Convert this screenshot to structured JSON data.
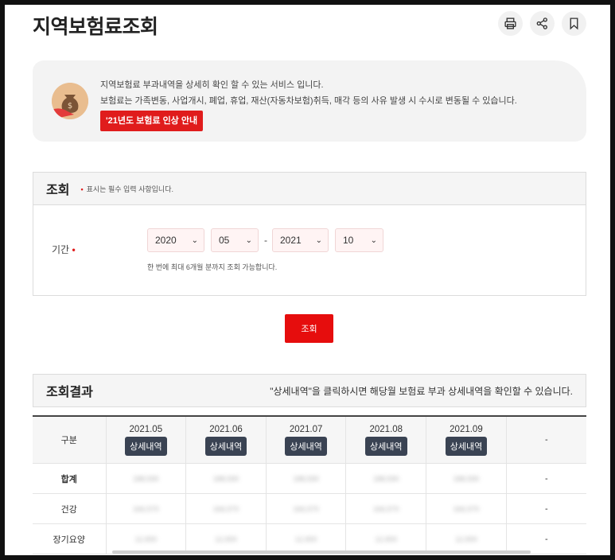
{
  "page": {
    "title": "지역보험료조회"
  },
  "toolbar": {
    "icons": [
      "print-icon",
      "share-icon",
      "bookmark-icon"
    ]
  },
  "info": {
    "line1": "지역보험료 부과내역을 상세히 확인 할 수 있는 서비스 입니다.",
    "line2": "보험료는 가족변동, 사업개시, 폐업, 휴업, 재산(자동차보험)취득, 매각 등의 사유 발생 시 수시로 변동될 수 있습니다.",
    "notice_label": "'21년도 보험료 인상 안내"
  },
  "query": {
    "heading": "조회",
    "required_note": "표시는 필수 입력 사항입니다.",
    "period_label": "기간",
    "from_year": "2020",
    "from_month": "05",
    "separator": "-",
    "to_year": "2021",
    "to_month": "10",
    "period_note": "한 번에 최대 6개월 분까지 조회 가능합니다.",
    "button": "조회"
  },
  "result": {
    "heading": "조회결과",
    "hint": "\"상세내역\"을 클릭하시면 해당월 보험료 부과 상세내역을 확인할 수 있습니다.",
    "col_header": "구분",
    "detail_label": "상세내역",
    "months": [
      "2021.05",
      "2021.06",
      "2021.07",
      "2021.08",
      "2021.09"
    ],
    "empty_col": "-",
    "rows": [
      {
        "label": "합계",
        "values": [
          "188,590",
          "188,590",
          "188,590",
          "188,590",
          "188,590"
        ],
        "last": "-"
      },
      {
        "label": "건강",
        "values": [
          "166,570",
          "166,570",
          "166,570",
          "166,570",
          "166,570"
        ],
        "last": "-"
      },
      {
        "label": "장기요양",
        "values": [
          "12,900",
          "12,900",
          "12,900",
          "12,900",
          "12,900"
        ],
        "last": "-"
      }
    ]
  },
  "colors": {
    "accent": "#e60d0d",
    "detail_button": "#3a4353"
  }
}
